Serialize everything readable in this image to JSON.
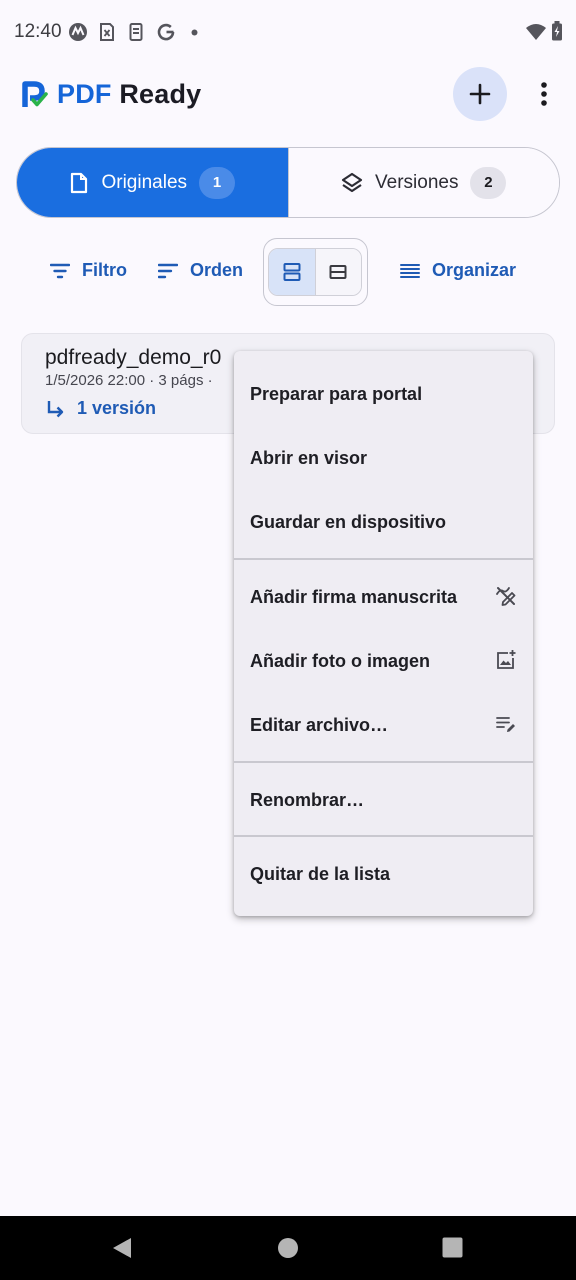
{
  "status_bar": {
    "time": "12:40",
    "left_icons": [
      "motorola-icon",
      "sim-x-icon",
      "clipboard-icon",
      "google-icon",
      "dot-icon"
    ],
    "right_icons": [
      "wifi-icon",
      "battery-charging-icon"
    ]
  },
  "app_bar": {
    "title_part1": "PDF",
    "title_part2": "Ready",
    "logo_icon": "pdfready-logo-icon",
    "add_icon": "plus-icon",
    "more_icon": "more-vert-icon"
  },
  "tabs": [
    {
      "label": "Originales",
      "count": "1",
      "icon": "document-icon",
      "active": true
    },
    {
      "label": "Versiones",
      "count": "2",
      "icon": "layers-icon",
      "active": false
    }
  ],
  "toolbar": {
    "filter_label": "Filtro",
    "sort_label": "Orden",
    "organize_label": "Organizar"
  },
  "file": {
    "name": "pdfready_demo_r0",
    "meta": "1/5/2026 22:00 · 3 págs ·",
    "versions_label": "1 versión"
  },
  "menu": {
    "items": [
      {
        "label": "Preparar para portal",
        "icon": ""
      },
      {
        "label": "Abrir en visor",
        "icon": ""
      },
      {
        "label": "Guardar en dispositivo",
        "icon": ""
      },
      {
        "label": "Añadir firma manuscrita",
        "icon": "draw-signature-icon"
      },
      {
        "label": "Añadir foto o imagen",
        "icon": "add-photo-icon"
      },
      {
        "label": "Editar archivo…",
        "icon": "edit-note-icon"
      },
      {
        "label": "Renombrar…",
        "icon": ""
      },
      {
        "label": "Quitar de la lista",
        "icon": ""
      }
    ]
  },
  "colors": {
    "primary": "#1a6ee0",
    "primary_text": "#1f5bb5",
    "background": "#fbf9fe",
    "menu_bg": "#efedf3"
  }
}
